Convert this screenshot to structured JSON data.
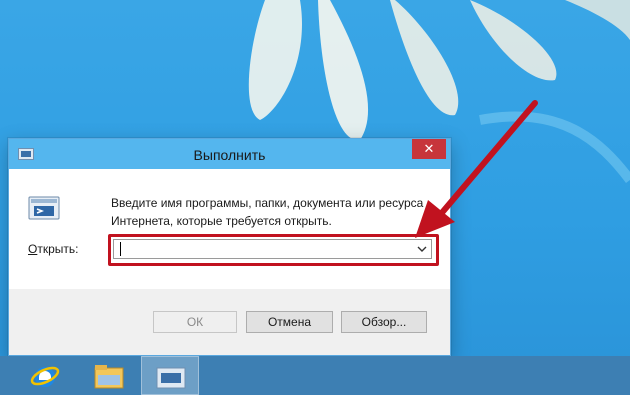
{
  "dialog": {
    "title": "Выполнить",
    "close_label": "✕",
    "description": "Введите имя программы, папки, документа или ресурса Интернета, которые требуется открыть.",
    "open_label_mnemonic": "О",
    "open_label_rest": "ткрыть:",
    "open_value": "",
    "buttons": {
      "ok": "ОК",
      "cancel": "Отмена",
      "browse": "Обзор..."
    }
  },
  "taskbar": {
    "items": [
      {
        "icon": "internet-explorer-icon"
      },
      {
        "icon": "file-explorer-icon"
      },
      {
        "icon": "run-icon",
        "active": true
      }
    ]
  },
  "colors": {
    "desktop": "#2f9ee2",
    "titlebar": "#54b6ee",
    "close": "#c7353b",
    "highlight": "#c1121f",
    "taskbar": "#3d7fb3"
  }
}
